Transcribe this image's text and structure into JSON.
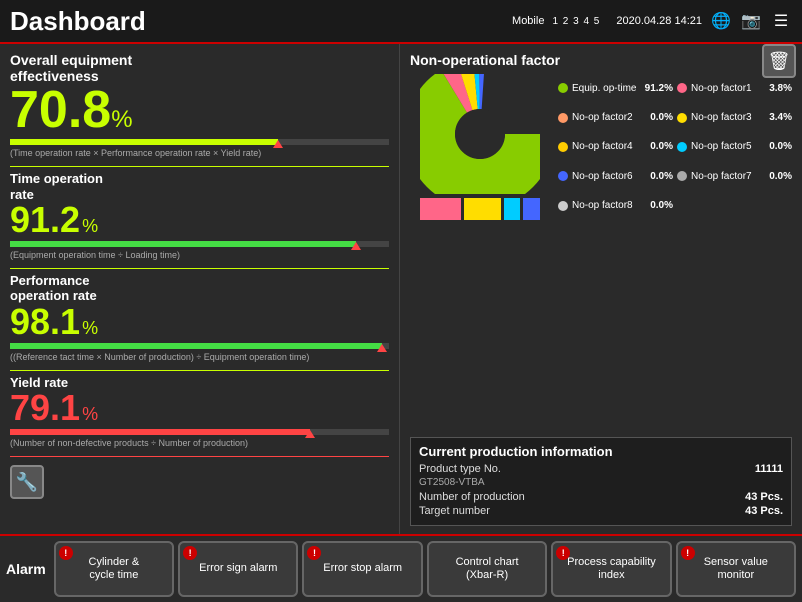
{
  "header": {
    "title": "Dashboard",
    "mobile_label": "Mobile",
    "mobile_dots": "1 2 3 4 5",
    "datetime": "2020.04.28  14:21",
    "globe_icon": "🌐",
    "camera_icon": "📷",
    "menu_icon": "☰"
  },
  "toolbar": {
    "trash_icon": "🗑"
  },
  "oee": {
    "title_line1": "Overall equipment",
    "title_line2": "effectiveness",
    "value": "70.8",
    "unit": "%",
    "bar_pct": 70.8,
    "marker_pct": 70.8,
    "formula": "(Time operation rate\n× Performance operation rate × Yield rate)"
  },
  "metrics": [
    {
      "id": "time-op-rate",
      "title_line1": "Time operation",
      "title_line2": "rate",
      "value": "91.2",
      "unit": "%",
      "color": "green",
      "bar_pct": 91.2,
      "marker_pct": 91.2,
      "formula": "(Equipment operation time ÷ Loading time)"
    },
    {
      "id": "performance-op-rate",
      "title_line1": "Performance",
      "title_line2": "operation rate",
      "value": "98.1",
      "unit": "%",
      "color": "green",
      "bar_pct": 98.1,
      "marker_pct": 98.1,
      "formula": "((Reference tact time × Number of production)\n÷ Equipment operation time)"
    },
    {
      "id": "yield-rate",
      "title_line1": "Yield rate",
      "title_line2": "",
      "value": "79.1",
      "unit": "%",
      "color": "red",
      "bar_pct": 79.1,
      "marker_pct": 79.1,
      "formula": "(Number of non-defective products\n÷ Number of production)"
    }
  ],
  "non_op": {
    "title": "Non-operational factor",
    "legend": [
      {
        "label": "Equip. op-time",
        "value": "91.2%",
        "color": "#88cc00"
      },
      {
        "label": "No-op factor1",
        "value": "3.8%",
        "color": "#ff6688"
      },
      {
        "label": "No-op factor2",
        "value": "0.0%",
        "color": "#ff9966"
      },
      {
        "label": "No-op factor3",
        "value": "3.4%",
        "color": "#ffdd00"
      },
      {
        "label": "No-op factor4",
        "value": "0.0%",
        "color": "#ffcc00"
      },
      {
        "label": "No-op factor5",
        "value": "0.0%",
        "color": "#00ccff"
      },
      {
        "label": "No-op factor6",
        "value": "0.0%",
        "color": "#4466ff"
      },
      {
        "label": "No-op factor7",
        "value": "0.0%",
        "color": "#aaaaaa"
      },
      {
        "label": "No-op factor8",
        "value": "0.0%",
        "color": "#cccccc"
      }
    ],
    "bar_segments": [
      {
        "color": "#ff6688",
        "pct": 37
      },
      {
        "color": "#ffdd00",
        "pct": 33
      },
      {
        "color": "#00ccff",
        "pct": 15
      },
      {
        "color": "#4466ff",
        "pct": 15
      }
    ]
  },
  "production": {
    "title": "Current production information",
    "rows": [
      {
        "label": "Product type No.",
        "value": "11111"
      },
      {
        "label": "GT2508-VTBA",
        "value": ""
      },
      {
        "label": "Number of production",
        "value": "43 Pcs."
      },
      {
        "label": "Target number",
        "value": "43 Pcs."
      }
    ]
  },
  "alarm": {
    "title": "Alarm",
    "buttons": [
      {
        "id": "cylinder",
        "label": "Cylinder &\ncycle time",
        "has_dot": true
      },
      {
        "id": "error-sign",
        "label": "Error sign alarm",
        "has_dot": true
      },
      {
        "id": "error-stop",
        "label": "Error stop alarm",
        "has_dot": true
      },
      {
        "id": "control",
        "label": "Control chart\n(Xbar-R)",
        "has_dot": false
      },
      {
        "id": "process-cap",
        "label": "Process capability\nindex",
        "has_dot": true
      },
      {
        "id": "sensor",
        "label": "Sensor value\nmonitor",
        "has_dot": true
      }
    ]
  }
}
